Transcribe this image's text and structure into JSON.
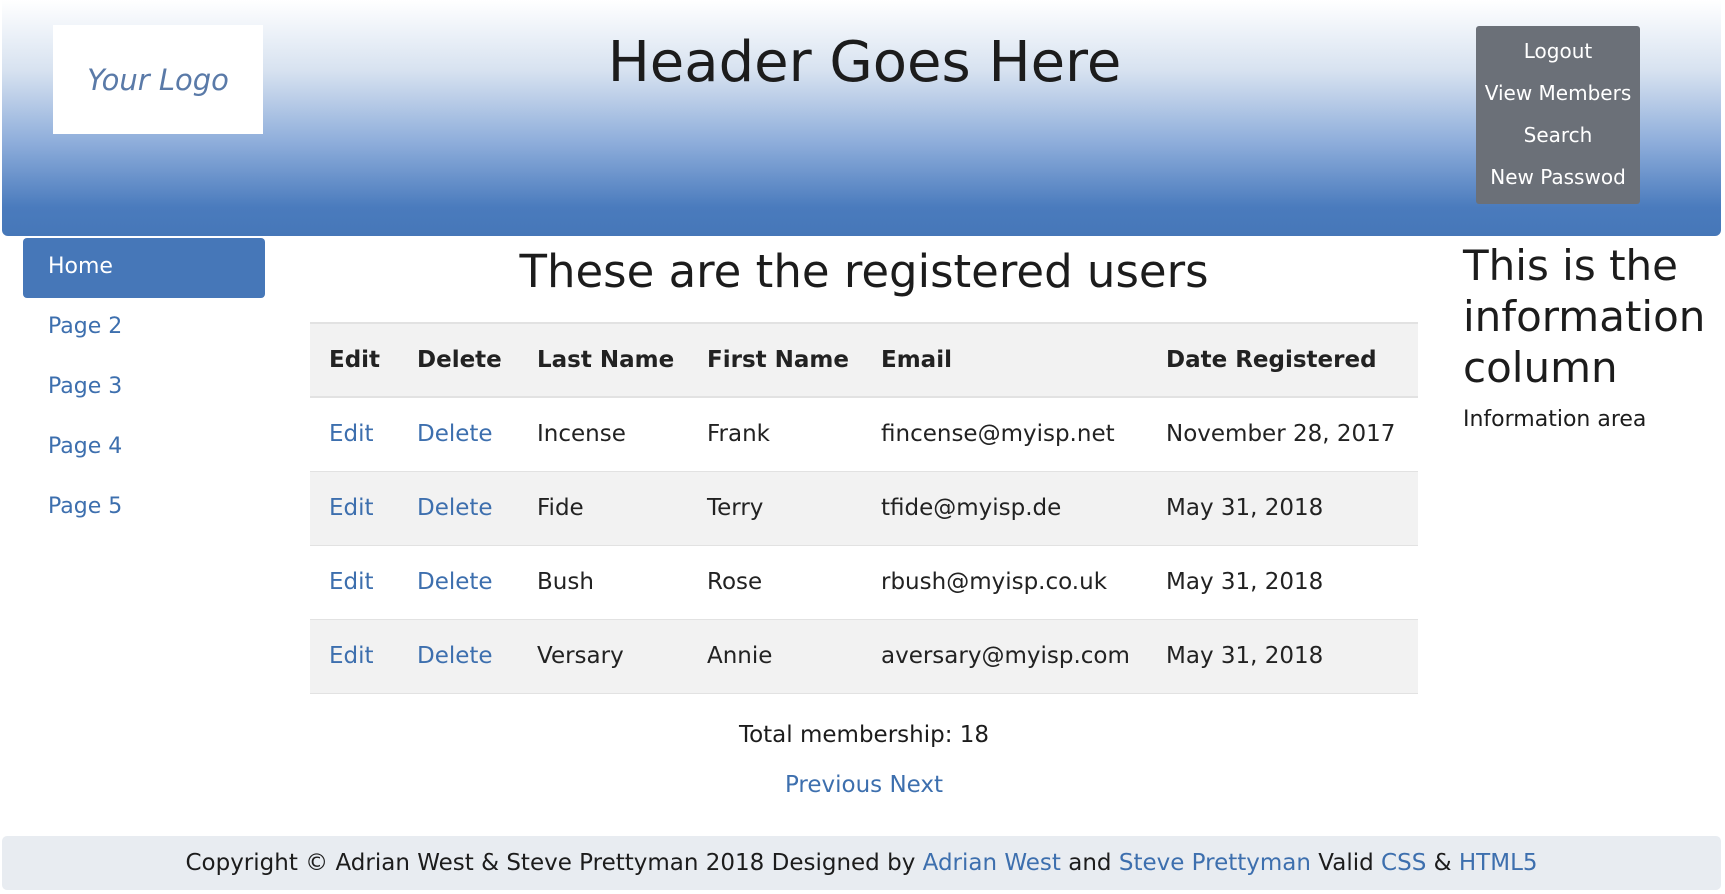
{
  "header": {
    "logo_text": "Your Logo",
    "title": "Header Goes Here",
    "nav": [
      "Logout",
      "View Members",
      "Search",
      "New Passwod"
    ]
  },
  "sidebar": {
    "items": [
      {
        "label": "Home",
        "active": true
      },
      {
        "label": "Page 2"
      },
      {
        "label": "Page 3"
      },
      {
        "label": "Page 4"
      },
      {
        "label": "Page 5"
      }
    ]
  },
  "main": {
    "title": "These are the registered users",
    "columns": [
      "Edit",
      "Delete",
      "Last Name",
      "First Name",
      "Email",
      "Date Registered"
    ],
    "rows": [
      {
        "edit": "Edit",
        "delete": "Delete",
        "last": "Incense",
        "first": "Frank",
        "email": "fincense@myisp.net",
        "date": "November 28, 2017"
      },
      {
        "edit": "Edit",
        "delete": "Delete",
        "last": "Fide",
        "first": "Terry",
        "email": "tfide@myisp.de",
        "date": "May 31, 2018"
      },
      {
        "edit": "Edit",
        "delete": "Delete",
        "last": "Bush",
        "first": "Rose",
        "email": "rbush@myisp.co.uk",
        "date": "May 31, 2018"
      },
      {
        "edit": "Edit",
        "delete": "Delete",
        "last": "Versary",
        "first": "Annie",
        "email": "aversary@myisp.com",
        "date": "May 31, 2018"
      }
    ],
    "total_text": "Total membership: 18",
    "pager": {
      "previous": "Previous",
      "next": "Next"
    }
  },
  "info": {
    "title": "This is the information column",
    "text": "Information area"
  },
  "footer": {
    "copyright": "Copyright © Adrian West & Steve Prettyman 2018 Designed by",
    "author1": "Adrian West",
    "and": "and",
    "author2": "Steve Prettyman",
    "valid": "Valid",
    "css": "CSS",
    "amp": "&",
    "html5": "HTML5"
  },
  "colors": {
    "accent": "#4677b8",
    "link": "#3d6fae",
    "nav_bg": "#6b7078",
    "row_alt": "#f2f2f2"
  }
}
